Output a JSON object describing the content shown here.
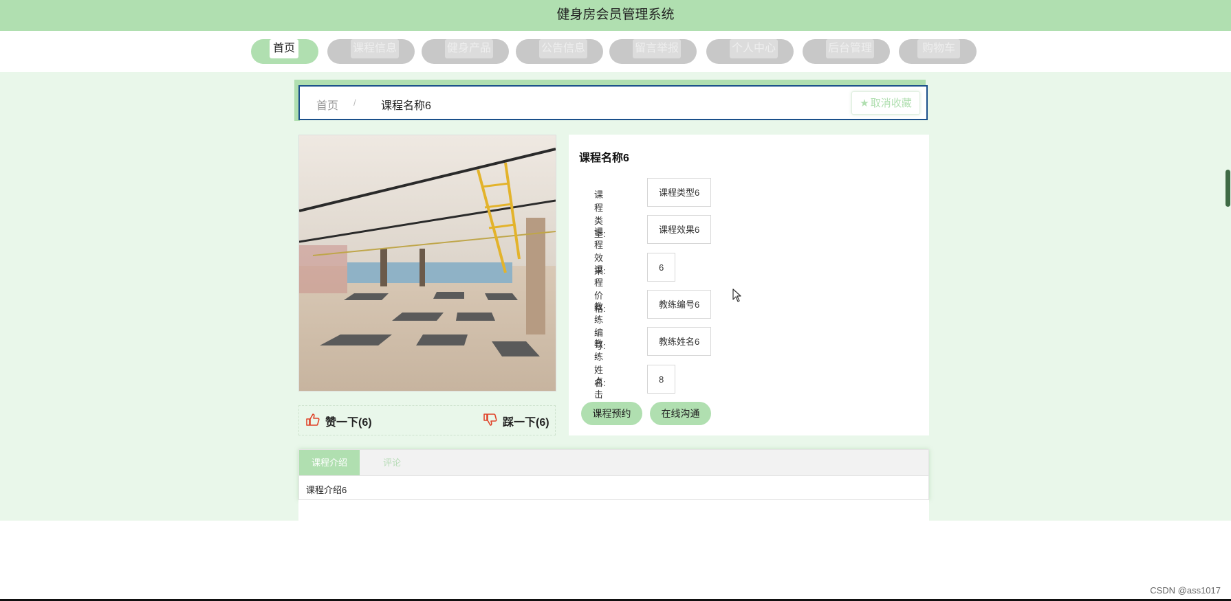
{
  "header": {
    "title": "健身房会员管理系统"
  },
  "nav": {
    "items": [
      {
        "label": "首页"
      },
      {
        "label": "课程信息"
      },
      {
        "label": "健身产品"
      },
      {
        "label": "公告信息"
      },
      {
        "label": "留言举报"
      },
      {
        "label": "个人中心"
      },
      {
        "label": "后台管理"
      },
      {
        "label": "购物车"
      }
    ]
  },
  "breadcrumb": {
    "home": "首页",
    "separator": "/",
    "current": "课程名称6",
    "favorite_label": "取消收藏"
  },
  "detail": {
    "title": "课程名称6",
    "fields": [
      {
        "label": "课程类型:",
        "value": "课程类型6"
      },
      {
        "label": "课程效果:",
        "value": "课程效果6"
      },
      {
        "label": "课程价格:",
        "value": "6"
      },
      {
        "label": "教练编号:",
        "value": "教练编号6"
      },
      {
        "label": "教练姓名:",
        "value": "教练姓名6"
      },
      {
        "label": "点击次数:",
        "value": "8"
      }
    ],
    "book_label": "课程预约",
    "chat_label": "在线沟通"
  },
  "votes": {
    "like_label": "赞一下(6)",
    "dislike_label": "踩一下(6)"
  },
  "tabs": {
    "items": [
      {
        "label": "课程介绍"
      },
      {
        "label": "评论"
      }
    ],
    "content": "课程介绍6"
  },
  "footer": {
    "watermark": "CSDN @ass1017"
  },
  "colors": {
    "brand_green": "#b0dfb0",
    "page_bg": "#e9f7ea",
    "breadcrumb_border": "#1a4f8a",
    "thumb_icon_red": "#e0442a"
  },
  "icons": {
    "favorite": "star-icon",
    "like": "thumbs-up-icon",
    "dislike": "thumbs-down-icon"
  }
}
